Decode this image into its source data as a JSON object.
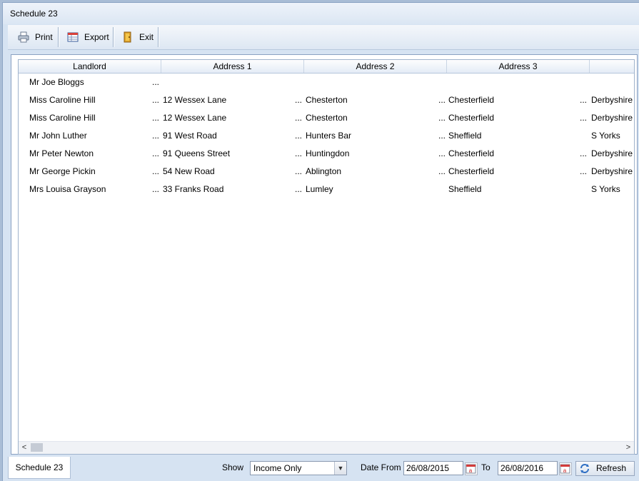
{
  "window": {
    "title": "Schedule 23"
  },
  "toolbar": {
    "print": "Print",
    "export": "Export",
    "exit": "Exit"
  },
  "grid": {
    "columns": [
      "Landlord",
      "Address 1",
      "Address 2",
      "Address 3"
    ],
    "ellipsis": "...",
    "rows": [
      {
        "landlord": "Mr Joe Bloggs",
        "a1": "",
        "a2": "",
        "a3": "",
        "a4": ""
      },
      {
        "landlord": "Miss Caroline Hill",
        "a1": "12 Wessex Lane",
        "a2": "Chesterton",
        "a3": "Chesterfield",
        "a4": "Derbyshire"
      },
      {
        "landlord": "Miss Caroline Hill",
        "a1": "12 Wessex Lane",
        "a2": "Chesterton",
        "a3": "Chesterfield",
        "a4": "Derbyshire"
      },
      {
        "landlord": "Mr John Luther",
        "a1": "91 West Road",
        "a2": "Hunters Bar",
        "a3": "Sheffield",
        "a4": "S Yorks"
      },
      {
        "landlord": "Mr Peter Newton",
        "a1": "91 Queens Street",
        "a2": "Huntingdon",
        "a3": "Chesterfield",
        "a4": "Derbyshire"
      },
      {
        "landlord": "Mr George Pickin",
        "a1": "54 New Road",
        "a2": "Ablington",
        "a3": "Chesterfield",
        "a4": "Derbyshire"
      },
      {
        "landlord": "Mrs Louisa Grayson",
        "a1": "33 Franks Road",
        "a2": "Lumley",
        "a3": "Sheffield",
        "a4": "S Yorks"
      }
    ]
  },
  "status": {
    "tab": "Schedule 23",
    "show_label": "Show",
    "show_value": "Income Only",
    "date_from_label": "Date From",
    "date_from": "26/08/2015",
    "to_label": "To",
    "date_to": "26/08/2016",
    "refresh": "Refresh"
  },
  "icons": {
    "print": "printer-icon",
    "export": "spreadsheet-icon",
    "exit": "door-icon",
    "calendar": "calendar-icon",
    "refresh": "refresh-icon"
  }
}
